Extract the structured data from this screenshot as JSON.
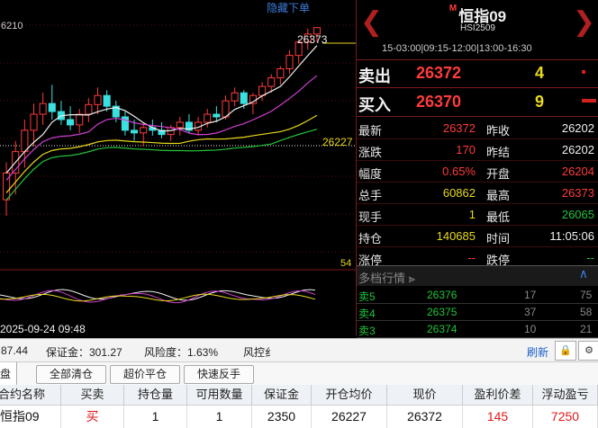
{
  "chart": {
    "hide_label": "隐藏下单",
    "price_top": "6210",
    "price_high_label": "26373",
    "price_mid_label": "26227",
    "vol_label": "54",
    "date_label": "2025-09-24 09:48"
  },
  "chart_data": {
    "type": "candlestick",
    "candles": [
      {
        "o": 26050,
        "h": 26120,
        "l": 26020,
        "c": 26100,
        "up": true
      },
      {
        "o": 26100,
        "h": 26160,
        "l": 26060,
        "c": 26140,
        "up": true
      },
      {
        "o": 26140,
        "h": 26200,
        "l": 26110,
        "c": 26180,
        "up": true
      },
      {
        "o": 26180,
        "h": 26230,
        "l": 26150,
        "c": 26210,
        "up": true
      },
      {
        "o": 26210,
        "h": 26250,
        "l": 26190,
        "c": 26230,
        "up": true
      },
      {
        "o": 26230,
        "h": 26265,
        "l": 26200,
        "c": 26215,
        "up": false
      },
      {
        "o": 26215,
        "h": 26235,
        "l": 26190,
        "c": 26200,
        "up": false
      },
      {
        "o": 26200,
        "h": 26225,
        "l": 26180,
        "c": 26190,
        "up": false
      },
      {
        "o": 26190,
        "h": 26220,
        "l": 26175,
        "c": 26210,
        "up": true
      },
      {
        "o": 26210,
        "h": 26240,
        "l": 26195,
        "c": 26228,
        "up": true
      },
      {
        "o": 26228,
        "h": 26260,
        "l": 26210,
        "c": 26245,
        "up": true
      },
      {
        "o": 26245,
        "h": 26255,
        "l": 26215,
        "c": 26225,
        "up": false
      },
      {
        "o": 26225,
        "h": 26235,
        "l": 26195,
        "c": 26205,
        "up": false
      },
      {
        "o": 26205,
        "h": 26215,
        "l": 26170,
        "c": 26180,
        "up": false
      },
      {
        "o": 26180,
        "h": 26200,
        "l": 26160,
        "c": 26175,
        "up": false
      },
      {
        "o": 26175,
        "h": 26195,
        "l": 26150,
        "c": 26185,
        "up": true
      },
      {
        "o": 26185,
        "h": 26200,
        "l": 26170,
        "c": 26180,
        "up": false
      },
      {
        "o": 26180,
        "h": 26195,
        "l": 26165,
        "c": 26172,
        "up": false
      },
      {
        "o": 26172,
        "h": 26190,
        "l": 26160,
        "c": 26185,
        "up": true
      },
      {
        "o": 26185,
        "h": 26205,
        "l": 26170,
        "c": 26195,
        "up": true
      },
      {
        "o": 26195,
        "h": 26210,
        "l": 26175,
        "c": 26180,
        "up": false
      },
      {
        "o": 26180,
        "h": 26205,
        "l": 26170,
        "c": 26195,
        "up": true
      },
      {
        "o": 26195,
        "h": 26220,
        "l": 26185,
        "c": 26210,
        "up": true
      },
      {
        "o": 26210,
        "h": 26225,
        "l": 26195,
        "c": 26205,
        "up": false
      },
      {
        "o": 26205,
        "h": 26245,
        "l": 26200,
        "c": 26235,
        "up": true
      },
      {
        "o": 26235,
        "h": 26260,
        "l": 26225,
        "c": 26250,
        "up": true
      },
      {
        "o": 26250,
        "h": 26255,
        "l": 26220,
        "c": 26230,
        "up": false
      },
      {
        "o": 26230,
        "h": 26250,
        "l": 26210,
        "c": 26245,
        "up": true
      },
      {
        "o": 26245,
        "h": 26270,
        "l": 26235,
        "c": 26262,
        "up": true
      },
      {
        "o": 26262,
        "h": 26285,
        "l": 26250,
        "c": 26278,
        "up": true
      },
      {
        "o": 26278,
        "h": 26300,
        "l": 26265,
        "c": 26295,
        "up": true
      },
      {
        "o": 26295,
        "h": 26330,
        "l": 26285,
        "c": 26320,
        "up": true
      },
      {
        "o": 26320,
        "h": 26350,
        "l": 26305,
        "c": 26345,
        "up": true
      },
      {
        "o": 26345,
        "h": 26370,
        "l": 26330,
        "c": 26360,
        "up": true
      },
      {
        "o": 26360,
        "h": 26373,
        "l": 26345,
        "c": 26372,
        "up": true
      }
    ],
    "ylim": [
      26020,
      26390
    ]
  },
  "panel": {
    "marker": "M",
    "title": "恒指09",
    "code": "HSI2509",
    "sessions": "15-03:00|09:15-12:00|13:00-16:30",
    "sell_label": "卖出",
    "sell_price": "26372",
    "sell_qty": "4",
    "buy_label": "买入",
    "buy_price": "26370",
    "buy_qty": "9",
    "quotes": [
      {
        "k1": "最新",
        "v1": "26372",
        "c1": "red",
        "k2": "昨收",
        "v2": "26202",
        "c2": "white"
      },
      {
        "k1": "涨跌",
        "v1": "170",
        "c1": "red",
        "k2": "昨结",
        "v2": "26202",
        "c2": "white"
      },
      {
        "k1": "幅度",
        "v1": "0.65%",
        "c1": "red",
        "k2": "开盘",
        "v2": "26204",
        "c2": "red"
      },
      {
        "k1": "总手",
        "v1": "60862",
        "c1": "yellow",
        "k2": "最高",
        "v2": "26373",
        "c2": "red"
      },
      {
        "k1": "现手",
        "v1": "1",
        "c1": "yellow",
        "k2": "最低",
        "v2": "26065",
        "c2": "green"
      },
      {
        "k1": "持仓",
        "v1": "140685",
        "c1": "yellow",
        "k2": "时间",
        "v2": "11:05:06",
        "c2": "white"
      },
      {
        "k1": "涨停",
        "v1": "--",
        "c1": "red",
        "k2": "跌停",
        "v2": "--",
        "c2": "green"
      }
    ],
    "multi_title": "多档行情",
    "levels": [
      {
        "name": "卖5",
        "price": "26376",
        "qty": "17",
        "extra": "75"
      },
      {
        "name": "卖4",
        "price": "26375",
        "qty": "37",
        "extra": "58"
      },
      {
        "name": "卖3",
        "price": "26374",
        "qty": "10",
        "extra": "21"
      }
    ]
  },
  "status": {
    "balance": "87.44",
    "margin_label": "保证金：301.27",
    "risk_label": "风险度：1.63%",
    "risk_ctrl": "风控纟",
    "refresh": "刷新"
  },
  "toolbar": {
    "tab": "盘",
    "clear_all": "全部清仓",
    "over_close": "超价平仓",
    "reverse": "快速反手"
  },
  "table": {
    "headers": [
      "合约名称",
      "买卖",
      "持仓量",
      "可用数量",
      "保证金",
      "开仓均价",
      "现价",
      "盈利价差",
      "浮动盈亏"
    ],
    "row": [
      "恒指09",
      "买",
      "1",
      "1",
      "2350",
      "26227",
      "26372",
      "145",
      "7250"
    ]
  }
}
